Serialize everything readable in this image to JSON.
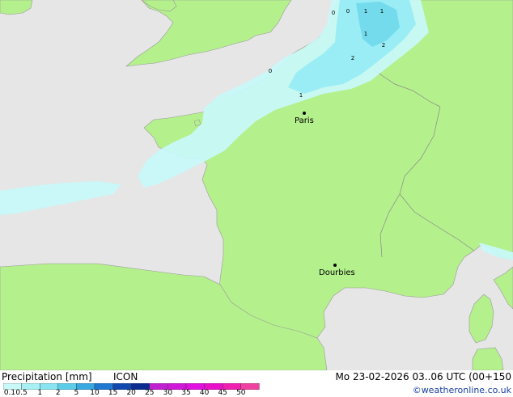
{
  "map": {
    "places": [
      {
        "name": "Paris"
      },
      {
        "name": "Dourbies"
      }
    ],
    "precip_labels": [
      "0",
      "0",
      "1",
      "1",
      "1",
      "2",
      "2",
      "0",
      "1"
    ]
  },
  "footer": {
    "title": "Precipitation [mm]",
    "model": "ICON",
    "datetime": "Mo 23-02-2026 03..06 UTC (00+150",
    "copyright": "©weatheronline.co.uk"
  },
  "legend": {
    "ticks": [
      "0.1",
      "0.5",
      "1",
      "2",
      "5",
      "10",
      "15",
      "20",
      "25",
      "30",
      "35",
      "40",
      "45",
      "50"
    ],
    "colors": [
      "#c8f8f8",
      "#a8f0f4",
      "#88e4f0",
      "#5ccce8",
      "#38a8e0",
      "#2078d0",
      "#1048b0",
      "#0c2c90",
      "#c020d0",
      "#d018d8",
      "#e010e0",
      "#e810c8",
      "#f020b0",
      "#f040a0"
    ]
  },
  "colors": {
    "land": "#b4f08c",
    "sea": "#e6e6e6",
    "precip_light": "#c8f8f8",
    "precip_mid": "#98ecf4",
    "precip_heavy": "#70d8ec"
  }
}
